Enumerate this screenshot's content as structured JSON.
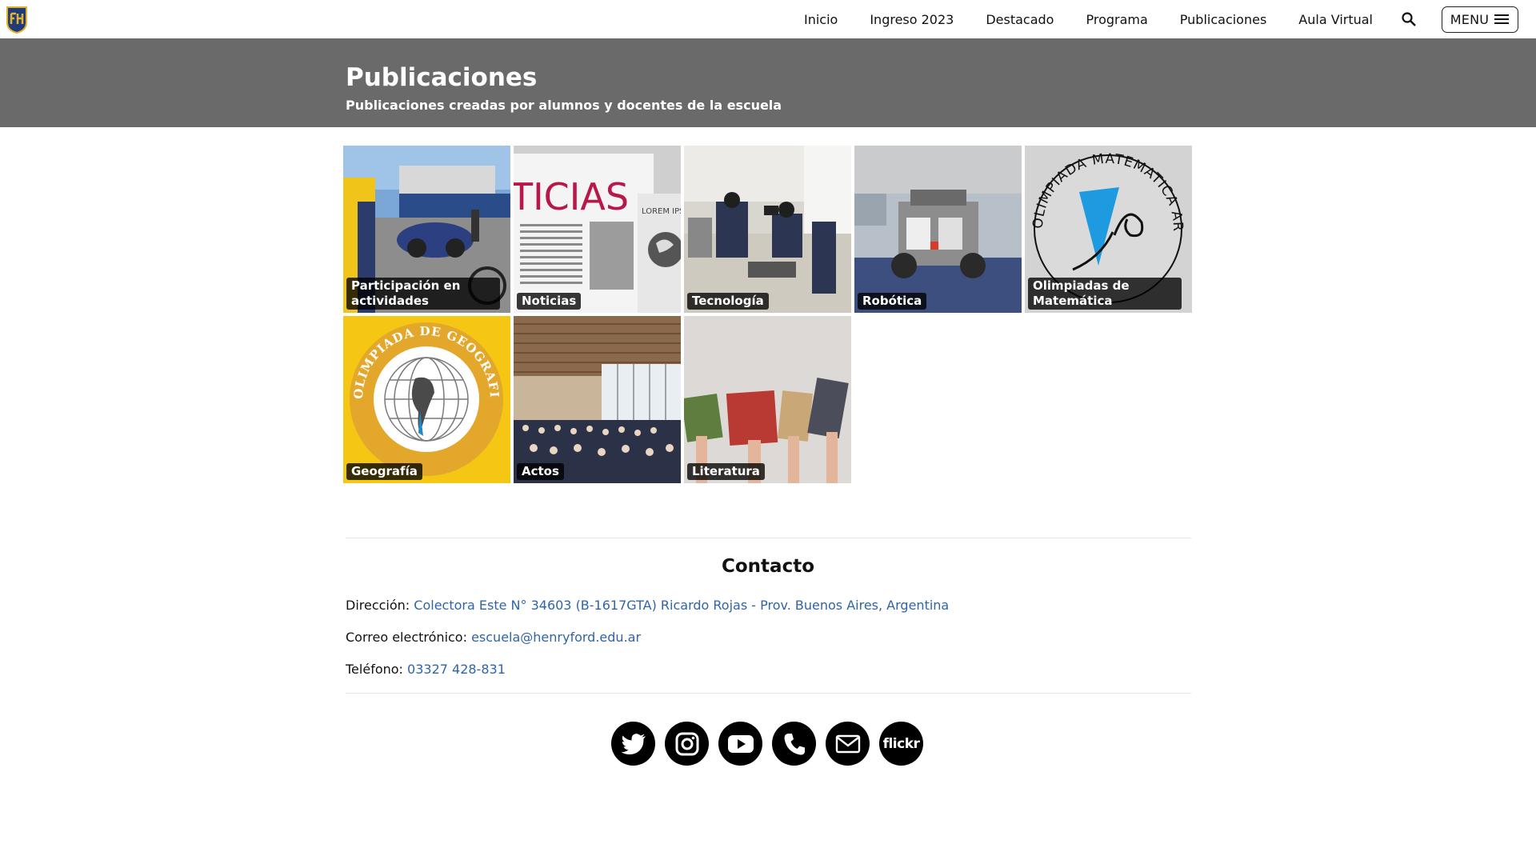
{
  "nav": {
    "items": [
      "Inicio",
      "Ingreso 2023",
      "Destacado",
      "Programa",
      "Publicaciones",
      "Aula Virtual"
    ],
    "menu_label": "MENU"
  },
  "hero": {
    "title": "Publicaciones",
    "subtitle": "Publicaciones creadas por alumnos y docentes de la escuela"
  },
  "tiles": [
    {
      "label": "Participación en actividades"
    },
    {
      "label": "Noticias",
      "image_text": "TICIAS",
      "image_text2": "LOREM IPSUM"
    },
    {
      "label": "Tecnología"
    },
    {
      "label": "Robótica"
    },
    {
      "label": "Olimpiadas de Matemática",
      "image_text": "OLIMPIADA MATEMATICA ARGENTINA"
    },
    {
      "label": "Geografía",
      "image_text": "OLIMPIADA DE GEOGRAFIA · DE LA REPUBLICA ARGENTINA"
    },
    {
      "label": "Actos"
    },
    {
      "label": "Literatura"
    }
  ],
  "contact": {
    "title": "Contacto",
    "address_label": "Dirección:",
    "address": "Colectora Este N° 34603 (B-1617GTA) Ricardo Rojas - Prov. Buenos Aires, Argentina",
    "email_label": "Correo electrónico:",
    "email": "escuela@henryford.edu.ar",
    "phone_label": "Teléfono:",
    "phone": "03327 428-831"
  },
  "social": {
    "icons": [
      "twitter-icon",
      "instagram-icon",
      "youtube-icon",
      "phone-icon",
      "mail-icon",
      "flickr-icon"
    ],
    "flickr_text": "flickr"
  },
  "colors": {
    "hero_bg": "#6a6a6a",
    "link": "#2f64a8",
    "logo_navy": "#1f3c78",
    "logo_gold": "#e5b12a"
  }
}
